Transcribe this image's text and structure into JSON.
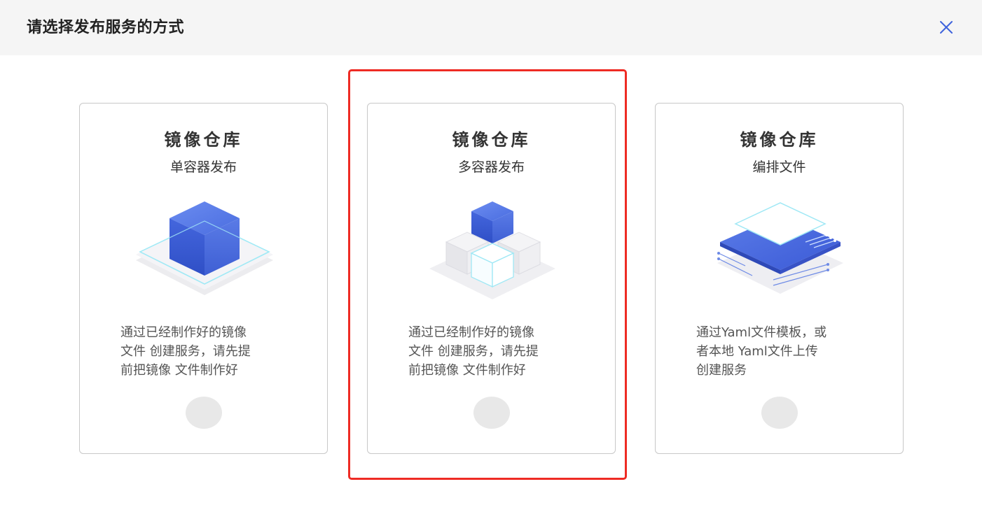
{
  "dialog": {
    "title": "请选择发布服务的方式",
    "close_icon": "close-icon"
  },
  "options": [
    {
      "title": "镜像仓库",
      "subtitle": "单容器发布",
      "illustration_icon": "single-cube-icon",
      "description_lines": [
        "通过已经制作好的镜像",
        "文件 创建服务，请先提",
        "前把镜像 文件制作好"
      ],
      "selected": false
    },
    {
      "title": "镜像仓库",
      "subtitle": "多容器发布",
      "illustration_icon": "multi-cube-icon",
      "description_lines": [
        "通过已经制作好的镜像",
        "文件 创建服务，请先提",
        "前把镜像 文件制作好"
      ],
      "selected": false,
      "highlighted": true
    },
    {
      "title": "镜像仓库",
      "subtitle": "编排文件",
      "illustration_icon": "layered-file-icon",
      "description_lines": [
        "通过Yaml文件模板，或",
        "者本地 Yaml文件上传",
        "创建服务"
      ],
      "selected": false
    }
  ],
  "colors": {
    "accent": "#3f63dc",
    "highlight_border": "#ee2b24",
    "header_bg": "#f5f5f5",
    "radio_bg": "#e8e8e8"
  }
}
